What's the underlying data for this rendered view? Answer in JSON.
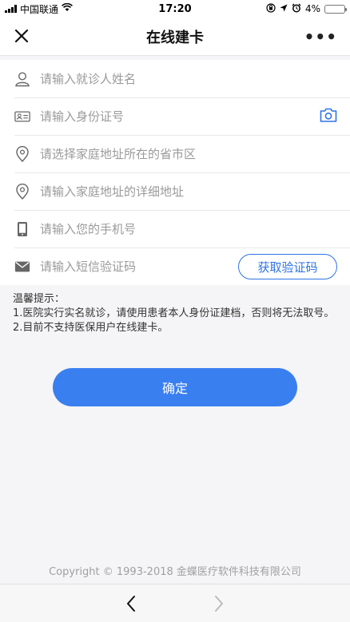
{
  "status_bar": {
    "carrier": "中国联通",
    "time": "17:20",
    "battery": "4%",
    "battery_level": 0.04
  },
  "nav": {
    "title": "在线建卡",
    "more": "•••"
  },
  "form": {
    "name_placeholder": "请输入就诊人姓名",
    "id_placeholder": "请输入身份证号",
    "region_placeholder": "请选择家庭地址所在的省市区",
    "address_placeholder": "请输入家庭地址的详细地址",
    "phone_placeholder": "请输入您的手机号",
    "sms_placeholder": "请输入短信验证码",
    "get_code_label": "获取验证码"
  },
  "tips": {
    "title": "温馨提示：",
    "line1": "1.医院实行实名就诊，请使用患者本人身份证建档，否则将无法取号。",
    "line2": "2.目前不支持医保用户在线建卡。"
  },
  "confirm_label": "确定",
  "footer": {
    "copyright": "Copyright © 1993-2018 金蝶医疗软件科技有限公司"
  },
  "colors": {
    "accent": "#3a7ff0",
    "code_button": "#2d73e3"
  }
}
